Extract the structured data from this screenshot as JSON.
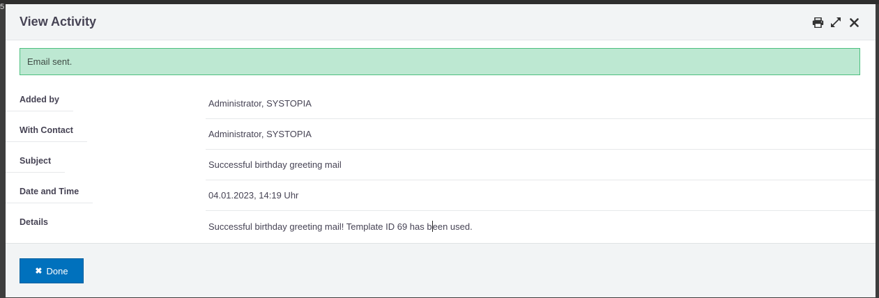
{
  "backdrop": {
    "corner_char": "5"
  },
  "dialog": {
    "title": "View Activity",
    "tools": [
      {
        "icon": "print-icon"
      },
      {
        "icon": "expand-icon"
      },
      {
        "icon": "close-icon"
      }
    ]
  },
  "alert": {
    "message": "Email sent."
  },
  "details": {
    "rows": [
      {
        "label": "Added by",
        "value": "Administrator, SYSTOPIA"
      },
      {
        "label": "With Contact",
        "value": "Administrator, SYSTOPIA"
      },
      {
        "label": "Subject",
        "value": "Successful birthday greeting mail"
      },
      {
        "label": "Date and Time",
        "value": "04.01.2023, 14:19 Uhr"
      },
      {
        "label": "Details",
        "value_before_caret": "Successful birthday greeting mail! Template ID 69 has b",
        "value_after_caret": "een used."
      }
    ]
  },
  "footer": {
    "done_label": "Done"
  },
  "colors": {
    "accent": "#0071bd",
    "success_bg": "#bde8d2",
    "success_border": "#4cbf7e",
    "text": "#464354"
  }
}
